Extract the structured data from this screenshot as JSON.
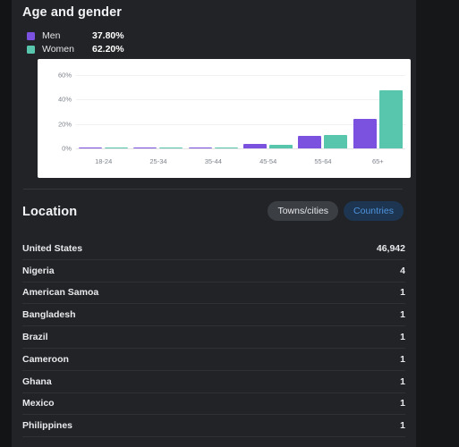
{
  "age_section": {
    "title": "Age and gender",
    "legend": [
      {
        "name": "men-legend",
        "label": "Men",
        "value": "37.80%",
        "color": "#7b52e0"
      },
      {
        "name": "women-legend",
        "label": "Women",
        "value": "62.20%",
        "color": "#57c6ad"
      }
    ]
  },
  "chart_data": {
    "type": "bar",
    "title": "Age and gender",
    "xlabel": "",
    "ylabel": "",
    "ylim": [
      0,
      65
    ],
    "grid": true,
    "legend_position": "above-chart",
    "categories": [
      "18-24",
      "25-34",
      "35-44",
      "45-54",
      "55-64",
      "65+"
    ],
    "ytick_labels": [
      "0%",
      "20%",
      "40%",
      "60%"
    ],
    "ytick_values": [
      0,
      20,
      40,
      60
    ],
    "series": [
      {
        "name": "Men",
        "color": "#7b52e0",
        "total": 37.8,
        "values": [
          0.7,
          0.7,
          1.0,
          4.0,
          10.0,
          24.0
        ]
      },
      {
        "name": "Women",
        "color": "#57c6ad",
        "total": 62.2,
        "values": [
          0.7,
          0.8,
          0.9,
          3.0,
          11.0,
          47.5
        ]
      }
    ]
  },
  "location_section": {
    "title": "Location",
    "toggles": [
      {
        "name": "towns-cities-toggle",
        "label": "Towns/cities",
        "active": false
      },
      {
        "name": "countries-toggle",
        "label": "Countries",
        "active": true
      }
    ],
    "rows": [
      {
        "country": "United States",
        "count": "46,942"
      },
      {
        "country": "Nigeria",
        "count": "4"
      },
      {
        "country": "American Samoa",
        "count": "1"
      },
      {
        "country": "Bangladesh",
        "count": "1"
      },
      {
        "country": "Brazil",
        "count": "1"
      },
      {
        "country": "Cameroon",
        "count": "1"
      },
      {
        "country": "Ghana",
        "count": "1"
      },
      {
        "country": "Mexico",
        "count": "1"
      },
      {
        "country": "Philippines",
        "count": "1"
      }
    ]
  },
  "colors": {
    "page_background": "#131416",
    "panel_background": "#212326",
    "accent_purple": "#7b52e0",
    "accent_teal": "#57c6ad",
    "accent_blue": "#4e94df",
    "divider": "#2e3135"
  }
}
